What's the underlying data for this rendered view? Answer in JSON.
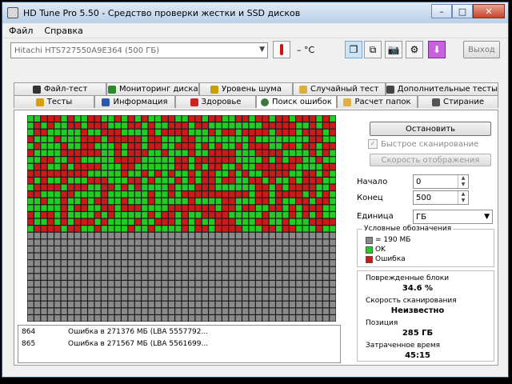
{
  "window": {
    "title": "HD Tune Pro 5.50 - Средство проверки жестки и SSD дисков"
  },
  "menu": {
    "items": [
      "Файл",
      "Справка"
    ]
  },
  "toolbar": {
    "disk": "Hitachi HTS727550A9E364 (500 ГБ)",
    "temperature": "– °C",
    "exit_label": "Выход"
  },
  "tabs": {
    "row1": [
      "Файл-тест",
      "Мониторинг диска",
      "Уровень шума",
      "Случайный тест",
      "Дополнительные тесты"
    ],
    "row2": [
      "Тесты",
      "Информация",
      "Здоровье",
      "Поиск ошибок",
      "Расчет папок",
      "Стирание"
    ]
  },
  "side": {
    "stop_label": "Остановить",
    "fast_scan_label": "Быстрое сканирование",
    "speed_label": "Скорость отображения",
    "start_label": "Начало",
    "start_value": "0",
    "end_label": "Конец",
    "end_value": "500",
    "unit_label": "Единица",
    "unit_value": "ГБ",
    "legend_title": "Условные обозначения",
    "legend": [
      "= 190 МБ",
      "OK",
      "Ошибка"
    ],
    "damaged_label": "Поврежденные блоки",
    "damaged_value": "34.6 %",
    "scan_speed_label": "Скорость сканирования",
    "scan_speed_value": "Неизвестно",
    "position_label": "Позиция",
    "position_value": "285 ГБ",
    "time_label": "Затраченное время",
    "time_value": "45:15"
  },
  "log": [
    {
      "lba": "864",
      "msg": "Ошибка в 271376 МБ (LBA 5557792..."
    },
    {
      "lba": "865",
      "msg": "Ошибка в 271567 МБ (LBA 5561699..."
    }
  ],
  "scan_map": {
    "columns": 46,
    "rows": 30,
    "scanned_rows": 17,
    "error_fraction": 0.346
  },
  "colors": {
    "ok": "#22cc22",
    "error": "#cc1a1a",
    "pending": "#8a8a8a"
  }
}
